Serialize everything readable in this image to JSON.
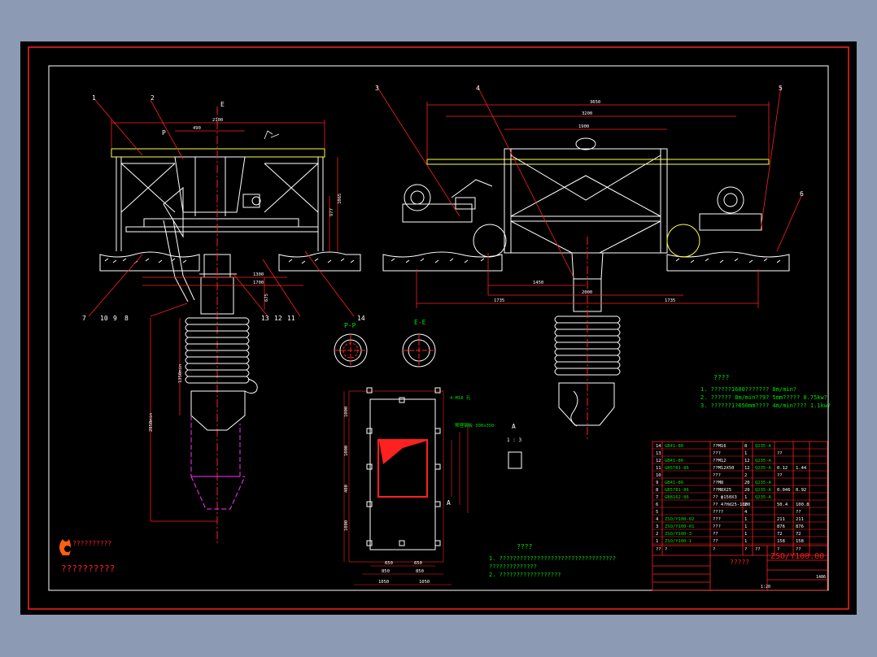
{
  "labels": {
    "callouts_left": [
      "1",
      "2",
      "E",
      "P"
    ],
    "callouts_bottom_left": [
      "7",
      "10",
      "9",
      "8",
      "13",
      "12",
      "11",
      "14"
    ],
    "callouts_right": [
      "3",
      "4",
      "5",
      "6"
    ],
    "section_pm": "P-P",
    "section_em": "E-E",
    "view_a": "A",
    "scale": "1 : 3"
  },
  "dimensions": {
    "left_top": "2100",
    "left_top2": "490",
    "left_mid": "1300",
    "left_mid2": "1700",
    "left_vert1": "1065",
    "left_vert2": "977",
    "left_vert3": "675",
    "left_vert4": "1350min",
    "left_vert5": "2850min",
    "right_top": "3650",
    "right_top2": "3200",
    "right_top3": "1900",
    "right_mid": "1450",
    "right_mid2": "2000",
    "right_bot1": "1735",
    "right_bot2": "1735",
    "center_bot1": "650",
    "center_bot2": "650",
    "center_bot3": "850",
    "center_bot4": "850",
    "center_bot5": "1050",
    "center_bot6": "1050",
    "center_left1": "1000",
    "center_left2": "1000",
    "center_left3": "400",
    "center_left4": "1000",
    "holes_note": "4-M16 孔",
    "plate_note": "预埋钢板 300x350"
  },
  "tech_req_right": {
    "title": "????",
    "items": [
      "1. ??????1600??????? 8m/min?",
      "2. ?????? 8m/min??9? 5mm????? 0.75kw?",
      "3. ??????1?650mm???? 4m/min???? 1.1kw?"
    ]
  },
  "tech_req_center": {
    "title": "????",
    "items": [
      "1. ??????????????????????????????????",
      "   ??????????????",
      "2. ??????????????????"
    ]
  },
  "logo": {
    "line1": "??????????",
    "line2": "??????????"
  },
  "bom": {
    "rows": [
      [
        "14",
        "GB41-86",
        "??M16",
        "8",
        "Q235-A",
        "",
        ""
      ],
      [
        "13",
        "",
        "???",
        "1",
        "",
        "??",
        ""
      ],
      [
        "12",
        "GB41-86",
        "??M12",
        "12",
        "Q235-A",
        "",
        ""
      ],
      [
        "11",
        "GB5781-86",
        "??M12X50",
        "12",
        "Q235-A",
        "0.12",
        "1.44"
      ],
      [
        "10",
        "",
        "???",
        "2",
        "",
        "??",
        ""
      ],
      [
        "9",
        "GB41-86",
        "??M8",
        "20",
        "Q235-A",
        "",
        ""
      ],
      [
        "8",
        "GB5781-86",
        "??M8X25",
        "20",
        "Q235-A",
        "0.046",
        "0.92"
      ],
      [
        "7",
        "GB8162-86",
        "?? ф150X3",
        "1",
        "Q235-A",
        "",
        ""
      ],
      [
        "6",
        "",
        "?? 4?Hd25-1000",
        "2",
        "",
        "50.4",
        "100.8"
      ],
      [
        "5",
        "",
        "????",
        "4",
        "",
        "",
        "??"
      ],
      [
        "4",
        "ZSO/Y100-02",
        "???",
        "1",
        "",
        "211",
        "211"
      ],
      [
        "3",
        "ZSO/Y100-01",
        "???",
        "1",
        "",
        "876",
        "876"
      ],
      [
        "2",
        "ZSO/Y100-3",
        "??",
        "1",
        "",
        "72",
        "72"
      ],
      [
        "1",
        "ZSO/Y100-1",
        "??",
        "1",
        "",
        "158",
        "158"
      ]
    ],
    "header": [
      "??",
      "?",
      "?",
      "?",
      "??",
      "?",
      "??"
    ],
    "title_block_name": "?????",
    "drawing_number": "ZSO/Y100.00",
    "scale_label": "1:20",
    "weight": "1486"
  }
}
